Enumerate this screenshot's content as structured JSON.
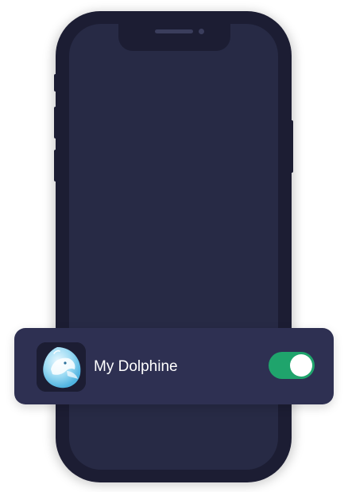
{
  "notification": {
    "app_name": "My Dolphine",
    "app_icon": "dolphin-icon",
    "toggle_on": true
  },
  "colors": {
    "phone_body": "#1c1d33",
    "screen": "#272a45",
    "card": "#2e3052",
    "toggle_accent": "#1fa46c"
  }
}
